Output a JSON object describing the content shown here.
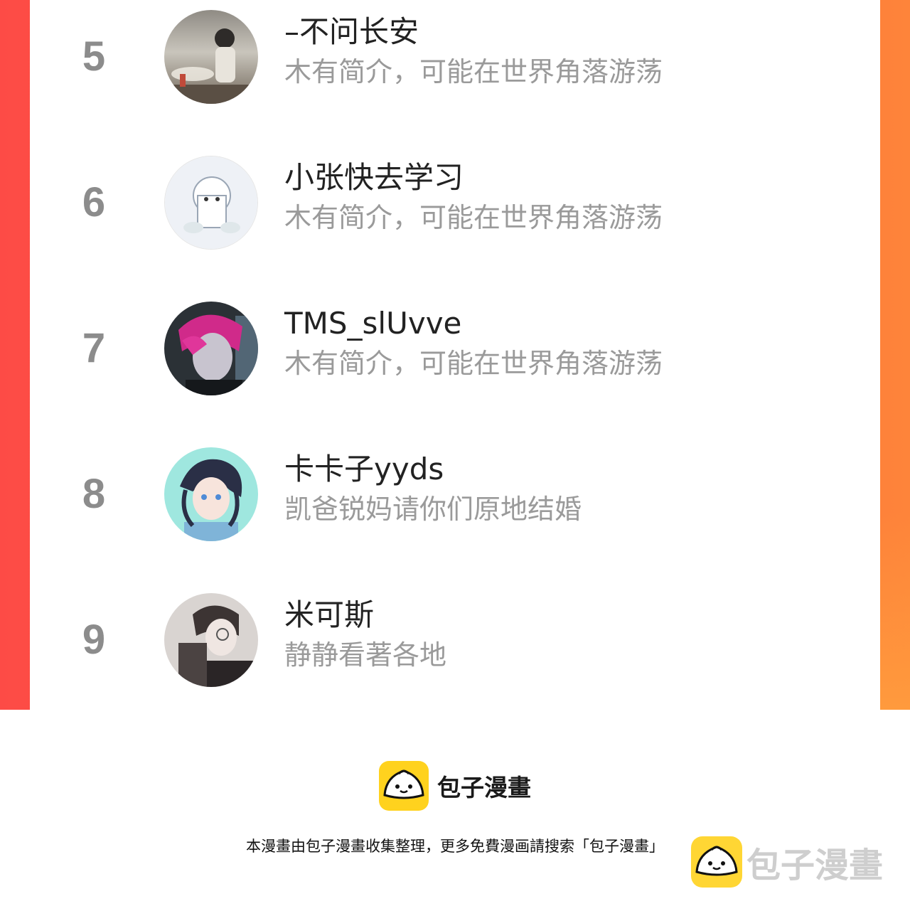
{
  "leaderboard": {
    "rows": [
      {
        "rank": "5",
        "name": "–不问长安",
        "bio": "木有简介，可能在世界角落游荡"
      },
      {
        "rank": "6",
        "name": "小张快去学习",
        "bio": "木有简介，可能在世界角落游荡"
      },
      {
        "rank": "7",
        "name": "TMS_slUvve",
        "bio": "木有简介，可能在世界角落游荡"
      },
      {
        "rank": "8",
        "name": "卡卡子yyds",
        "bio": "凯爸锐妈请你们原地结婚"
      },
      {
        "rank": "9",
        "name": "米可斯",
        "bio": "静静看著各地"
      }
    ]
  },
  "footer": {
    "brand_name": "包子漫畫",
    "note": "本漫畫由包子漫畫收集整理，更多免費漫画請搜索「包子漫畫」",
    "watermark_text": "包子漫畫"
  },
  "colors": {
    "frame_left": "#fd4b46",
    "frame_right": "#fe843a",
    "logo_yellow": "#ffd21e"
  }
}
